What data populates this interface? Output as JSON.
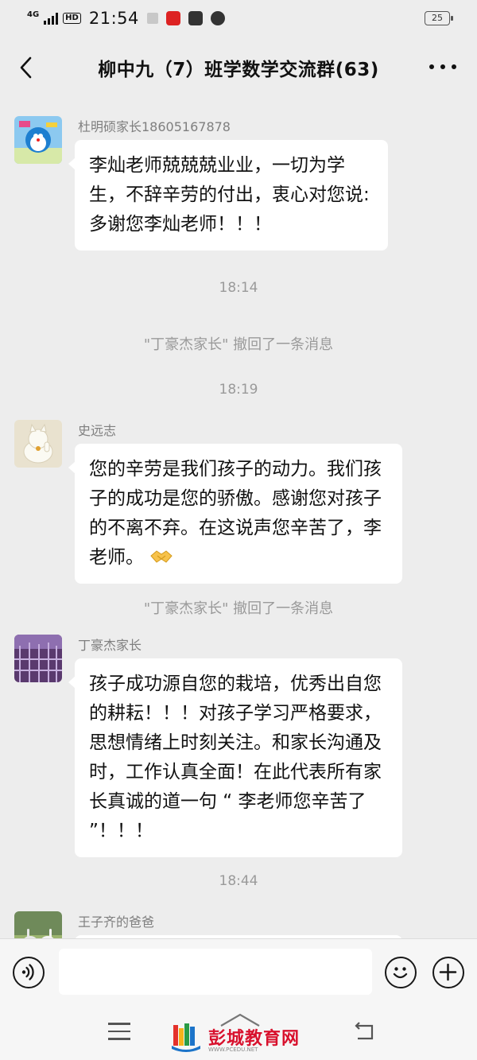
{
  "status_bar": {
    "network": "4G",
    "hd": "HD",
    "time": "21:54",
    "battery": "25"
  },
  "header": {
    "title": "柳中九（7）班学数学交流群(63)"
  },
  "messages": [
    {
      "sender": "杜明硕家长18605167878",
      "text": "李灿老师兢兢兢业业，一切为学生，不辞辛劳的付出，衷心对您说:多谢您李灿老师！！！"
    },
    {
      "time": "18:14"
    },
    {
      "system": "\"丁豪杰家长\" 撤回了一条消息"
    },
    {
      "time": "18:19"
    },
    {
      "sender": "史远志",
      "text": "您的辛劳是我们孩子的动力。我们孩子的成功是您的骄傲。感谢您对孩子的不离不弃。在这说声您辛苦了，李老师。"
    },
    {
      "system": "\"丁豪杰家长\" 撤回了一条消息"
    },
    {
      "sender": "丁豪杰家长",
      "text": "孩子成功源自您的栽培，优秀出自您的耕耘！！！对孩子学习严格要求，思想情绪上时刻关注。和家长沟通及时，工作认真全面！在此代表所有家长真诚的道一句 “ 李老师您辛苦了 ”！！！"
    },
    {
      "time": "18:44"
    },
    {
      "sender": "王子齐的爸爸"
    }
  ],
  "watermark": {
    "text": "彭城教育网",
    "url": "WWW.PCEDU.NET"
  },
  "icons": {
    "back": "chevron-left-icon",
    "more": "more-dots-icon",
    "voice": "voice-icon",
    "emoji": "emoji-icon",
    "plus": "plus-icon",
    "handshake": "handshake-icon"
  },
  "colors": {
    "chat_bg": "#ededed",
    "bubble": "#ffffff",
    "meta_text": "#9a9a9a",
    "logo_red": "#d8112d"
  }
}
